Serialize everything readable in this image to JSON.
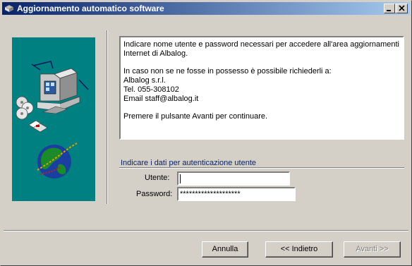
{
  "window": {
    "title": "Aggiornamento automatico software",
    "controls": {
      "minimize": "minimize",
      "maximize": "maximize",
      "close": "close"
    }
  },
  "info": {
    "line1": "Indicare nome utente e password necessari per accedere all'area aggiornamenti",
    "line2": "Internet di Albalog.",
    "line3": "In caso non se ne fosse in possesso è possibile richiederli a:",
    "line4": "Albalog s.r.l.",
    "line5": "Tel. 055-308102",
    "line6": "Email staff@albalog.it",
    "line7": "Premere il pulsante Avanti per continuare."
  },
  "auth": {
    "group_title": "Indicare i dati per autenticazione utente",
    "user_label": "Utente:",
    "user_value": "",
    "password_label": "Password:",
    "password_value": "********************"
  },
  "buttons": {
    "cancel": "Annulla",
    "back": "<< Indietro",
    "next": "Avanti >>",
    "next_enabled": false
  },
  "colors": {
    "titlebar_start": "#0a246a",
    "titlebar_end": "#a6caf0",
    "side_panel": "#008080",
    "face": "#d4d0c8"
  }
}
